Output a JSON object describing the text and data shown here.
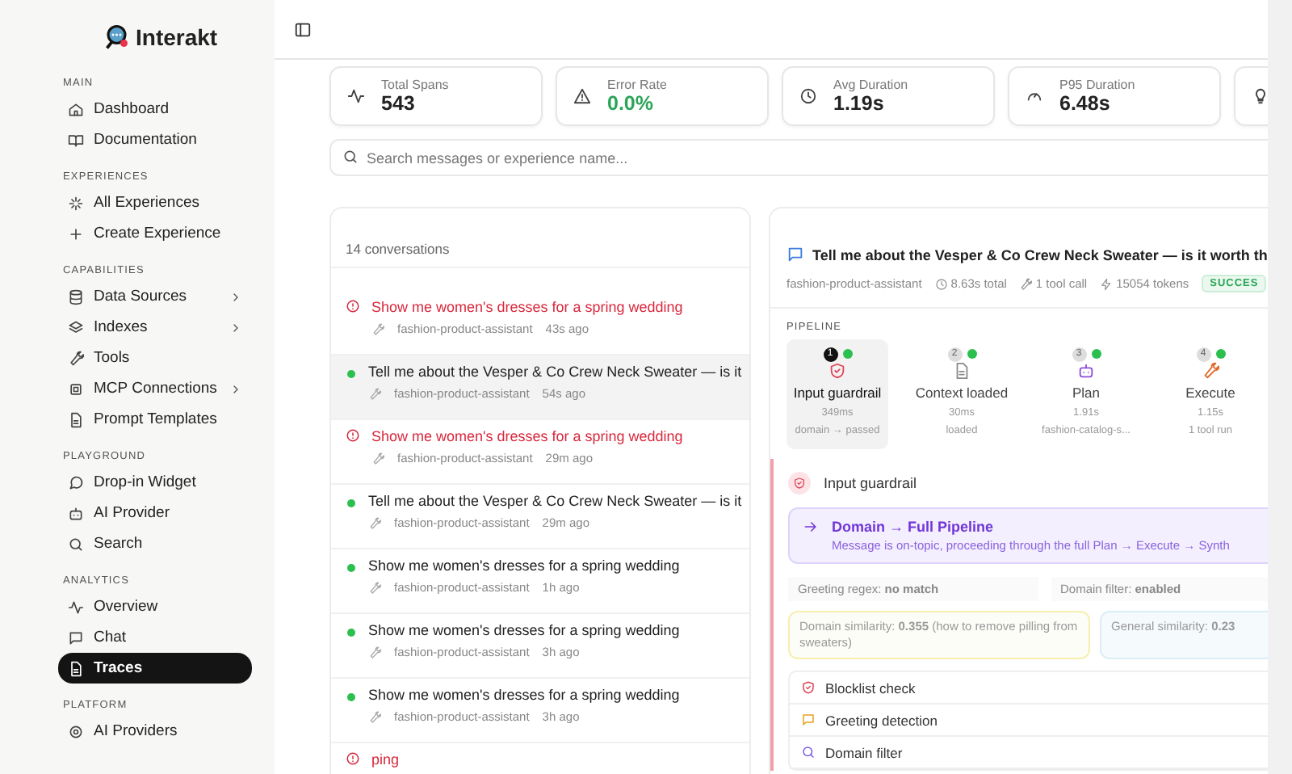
{
  "brand": {
    "name": "Interakt"
  },
  "sidebar": {
    "sections": [
      {
        "title": "MAIN",
        "items": [
          {
            "label": "Dashboard",
            "selected": false,
            "has_submenu": false
          },
          {
            "label": "Documentation",
            "selected": false,
            "has_submenu": false
          }
        ]
      },
      {
        "title": "EXPERIENCES",
        "items": [
          {
            "label": "All Experiences",
            "selected": false,
            "has_submenu": false
          },
          {
            "label": "Create Experience",
            "selected": false,
            "has_submenu": false
          }
        ]
      },
      {
        "title": "CAPABILITIES",
        "items": [
          {
            "label": "Data Sources",
            "selected": false,
            "has_submenu": true
          },
          {
            "label": "Indexes",
            "selected": false,
            "has_submenu": true
          },
          {
            "label": "Tools",
            "selected": false,
            "has_submenu": false
          },
          {
            "label": "MCP Connections",
            "selected": false,
            "has_submenu": true
          },
          {
            "label": "Prompt Templates",
            "selected": false,
            "has_submenu": false
          }
        ]
      },
      {
        "title": "PLAYGROUND",
        "items": [
          {
            "label": "Drop-in Widget",
            "selected": false,
            "has_submenu": false
          },
          {
            "label": "AI Provider",
            "selected": false,
            "has_submenu": false
          },
          {
            "label": "Search",
            "selected": false,
            "has_submenu": false
          }
        ]
      },
      {
        "title": "ANALYTICS",
        "items": [
          {
            "label": "Overview",
            "selected": false,
            "has_submenu": false
          },
          {
            "label": "Chat",
            "selected": false,
            "has_submenu": false
          },
          {
            "label": "Traces",
            "selected": true,
            "has_submenu": false
          }
        ]
      },
      {
        "title": "PLATFORM",
        "items": [
          {
            "label": "AI Providers",
            "selected": false,
            "has_submenu": false
          }
        ]
      }
    ]
  },
  "stats": [
    {
      "label": "Total Spans",
      "value": "543",
      "positive": false
    },
    {
      "label": "Error Rate",
      "value": "0.0%",
      "positive": true
    },
    {
      "label": "Avg Duration",
      "value": "1.19s",
      "positive": false
    },
    {
      "label": "P95 Duration",
      "value": "6.48s",
      "positive": false
    }
  ],
  "search": {
    "placeholder": "Search messages or experience name..."
  },
  "conversations": {
    "count": "14 conversations",
    "items": [
      {
        "title": "Show me women's dresses for a spring wedding",
        "error": true,
        "assistant": "fashion-product-assistant",
        "time": "43s ago",
        "selected": false
      },
      {
        "title": "Tell me about the Vesper & Co Crew Neck Sweater — is it",
        "error": false,
        "assistant": "fashion-product-assistant",
        "time": "54s ago",
        "selected": true
      },
      {
        "title": "Show me women's dresses for a spring wedding",
        "error": true,
        "assistant": "fashion-product-assistant",
        "time": "29m ago",
        "selected": false
      },
      {
        "title": "Tell me about the Vesper & Co Crew Neck Sweater — is it",
        "error": false,
        "assistant": "fashion-product-assistant",
        "time": "29m ago",
        "selected": false
      },
      {
        "title": "Show me women's dresses for a spring wedding",
        "error": false,
        "assistant": "fashion-product-assistant",
        "time": "1h ago",
        "selected": false
      },
      {
        "title": "Show me women's dresses for a spring wedding",
        "error": false,
        "assistant": "fashion-product-assistant",
        "time": "3h ago",
        "selected": false
      },
      {
        "title": "Show me women's dresses for a spring wedding",
        "error": false,
        "assistant": "fashion-product-assistant",
        "time": "3h ago",
        "selected": false
      },
      {
        "title": "ping",
        "error": true,
        "selected": false
      }
    ]
  },
  "detail": {
    "title": "Tell me about the Vesper & Co Crew Neck Sweater — is it worth th",
    "assistant": "fashion-product-assistant",
    "total": "8.63s total",
    "tool_calls": "1 tool call",
    "tokens": "15054 tokens",
    "badge": "SUCCES",
    "pipeline_label": "PIPELINE",
    "steps": [
      {
        "number": "1",
        "name": "Input guardrail",
        "duration": "349ms",
        "detail": "domain → passed",
        "selected": true
      },
      {
        "number": "2",
        "name": "Context loaded",
        "duration": "30ms",
        "detail": "loaded",
        "selected": false
      },
      {
        "number": "3",
        "name": "Plan",
        "duration": "1.91s",
        "detail": "fashion-catalog-s...",
        "selected": false
      },
      {
        "number": "4",
        "name": "Execute",
        "duration": "1.15s",
        "detail": "1 tool run",
        "selected": false
      }
    ],
    "section_title": "Input guardrail",
    "route": {
      "title": "Domain → Full Pipeline",
      "text": "Message is on-topic, proceeding through the full Plan → Execute → Synth"
    },
    "facts": [
      {
        "text": "Greeting regex: **no match**"
      },
      {
        "text": "Domain filter: **enabled**"
      }
    ],
    "similarities": [
      {
        "text": "Domain similarity: **0.355** (how to remove pilling from sweaters)"
      },
      {
        "text": "General similarity: **0.23**"
      }
    ],
    "checks": [
      {
        "label": "Blocklist check"
      },
      {
        "label": "Greeting detection"
      },
      {
        "label": "Domain filter"
      }
    ]
  }
}
